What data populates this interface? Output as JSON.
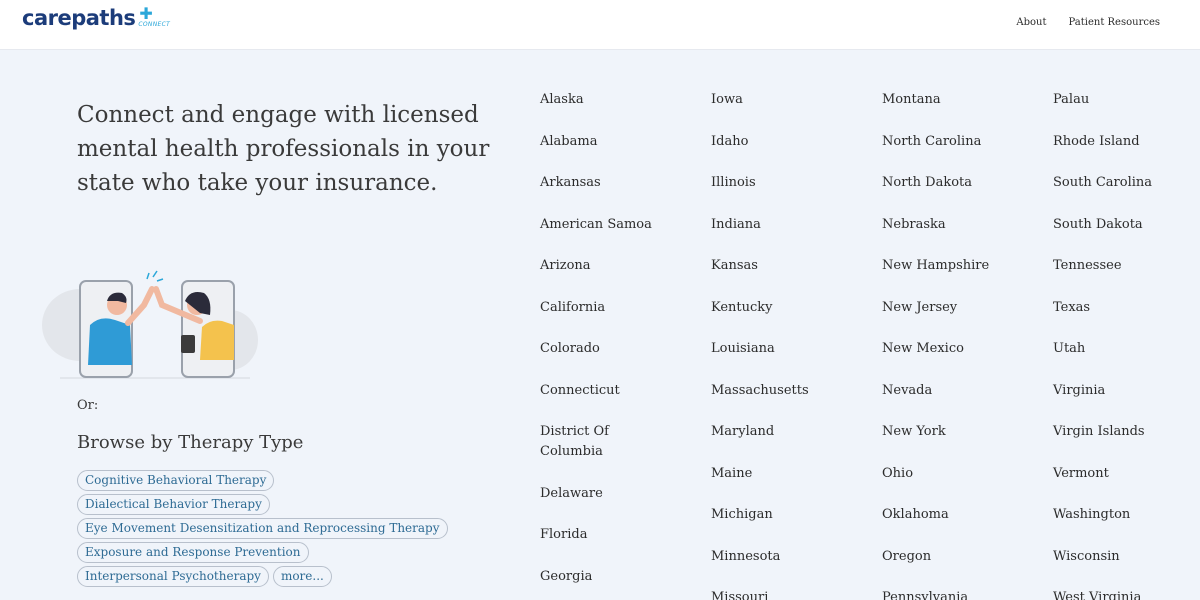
{
  "header": {
    "logo_text": "carepaths",
    "logo_sub": "CONNECT",
    "nav": [
      "About",
      "Patient Resources"
    ]
  },
  "hero": {
    "headline": "Connect and engage with licensed mental health professionals in your state who take your insurance."
  },
  "or_label": "Or:",
  "browse": {
    "title": "Browse by Therapy Type",
    "chips": [
      "Cognitive Behavioral Therapy",
      "Dialectical Behavior Therapy",
      "Eye Movement Desensitization and Reprocessing Therapy",
      "Exposure and Response Prevention",
      "Interpersonal Psychotherapy"
    ],
    "more_label": "more..."
  },
  "states": {
    "columns": [
      [
        "Alaska",
        "Alabama",
        "Arkansas",
        "American Samoa",
        "Arizona",
        "California",
        "Colorado",
        "Connecticut",
        "District Of Columbia",
        "Delaware",
        "Florida",
        "Georgia"
      ],
      [
        "Iowa",
        "Idaho",
        "Illinois",
        "Indiana",
        "Kansas",
        "Kentucky",
        "Louisiana",
        "Massachusetts",
        "Maryland",
        "Maine",
        "Michigan",
        "Minnesota",
        "Missouri"
      ],
      [
        "Montana",
        "North Carolina",
        "North Dakota",
        "Nebraska",
        "New Hampshire",
        "New Jersey",
        "New Mexico",
        "Nevada",
        "New York",
        "Ohio",
        "Oklahoma",
        "Oregon",
        "Pennsylvania"
      ],
      [
        "Palau",
        "Rhode Island",
        "South Carolina",
        "South Dakota",
        "Tennessee",
        "Texas",
        "Utah",
        "Virginia",
        "Virgin Islands",
        "Vermont",
        "Washington",
        "Wisconsin",
        "West Virginia"
      ]
    ]
  },
  "colors": {
    "background": "#f0f4fa",
    "brand": "#1c3c7a",
    "accent": "#2ba7d9",
    "chip_text": "#2e6b94"
  }
}
